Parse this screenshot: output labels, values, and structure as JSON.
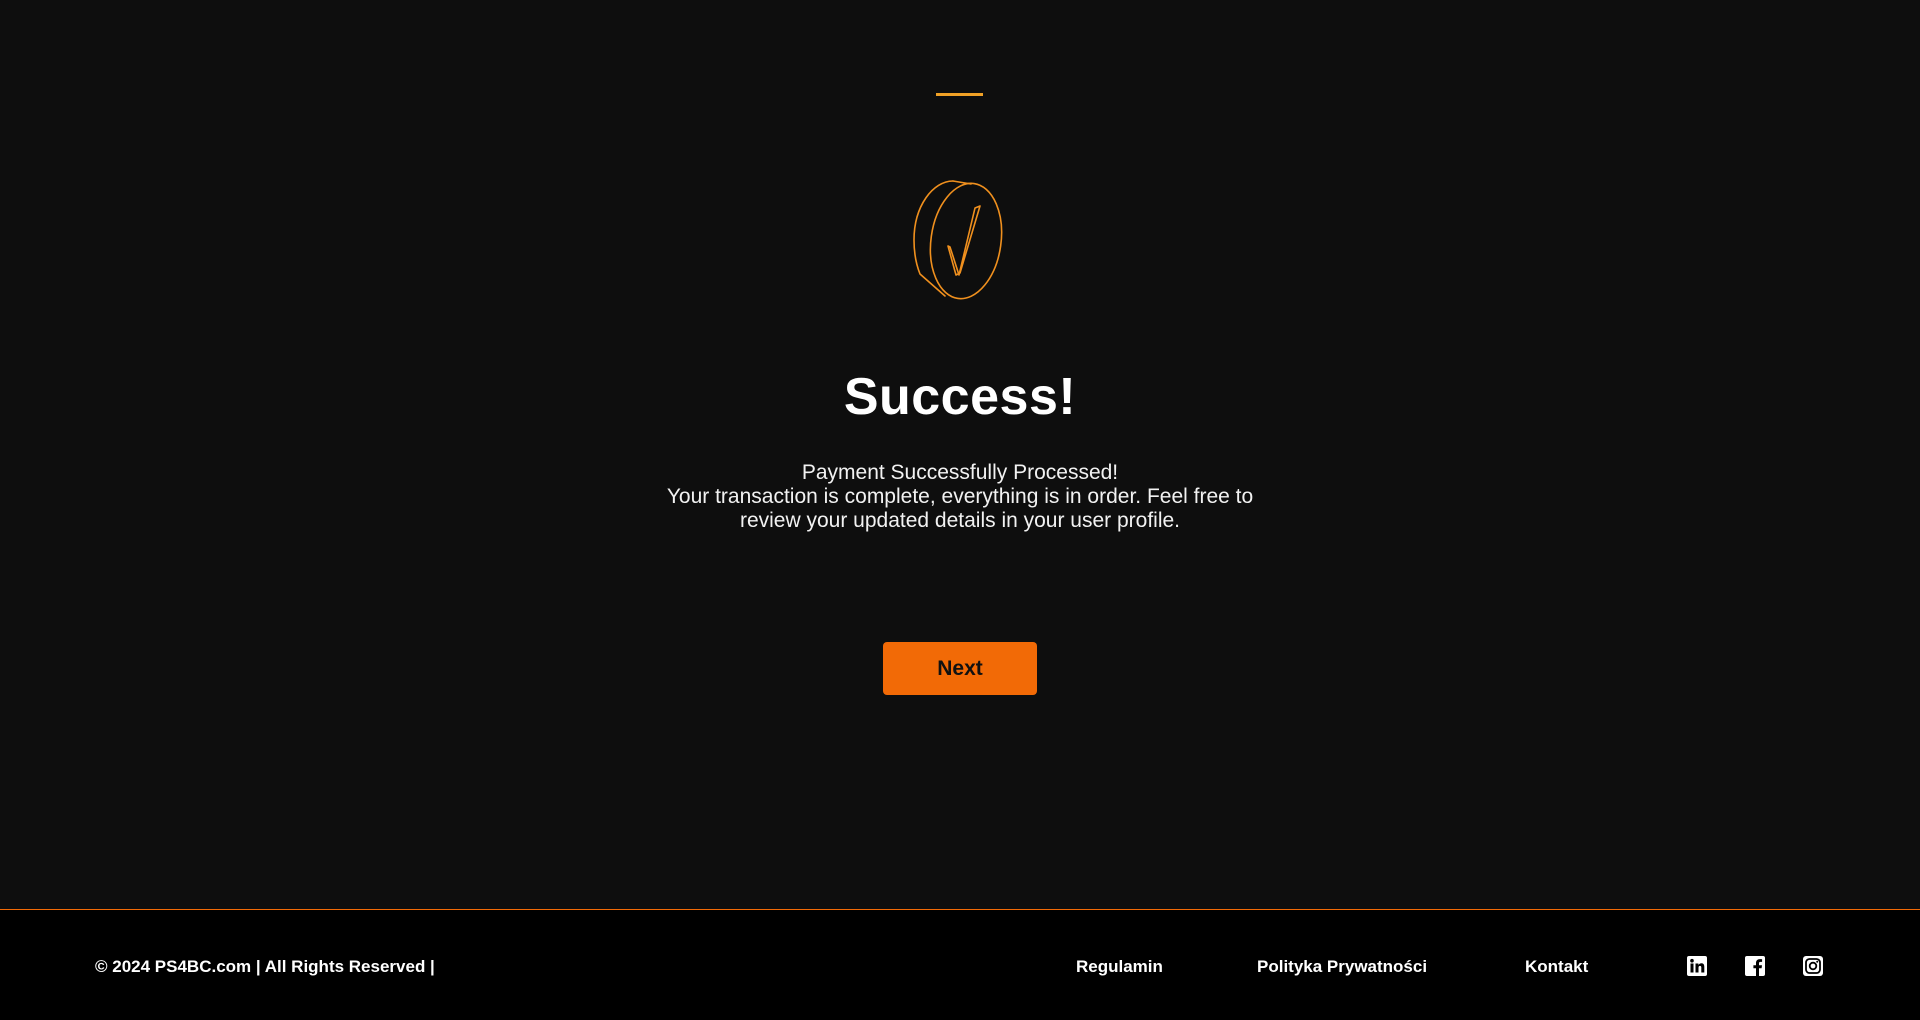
{
  "main": {
    "title": "Success!",
    "message_lines": [
      "Payment Successfully Processed!",
      "Your transaction is complete, everything is in order. Feel free to",
      "review your updated details in your user profile."
    ],
    "icon": "checkmark-coin-icon",
    "next_button": "Next"
  },
  "footer": {
    "copyright": "© 2024 PS4BC.com | All Rights Reserved |",
    "links": [
      "Regulamin",
      "Polityka Prywatności",
      "Kontakt"
    ],
    "social": [
      "linkedin-icon",
      "facebook-icon",
      "instagram-icon"
    ]
  },
  "colors": {
    "background": "#0e0e0e",
    "accent": "#f26a06",
    "accent_line": "#f0a126",
    "footer_background": "#000000",
    "text": "#ffffff"
  }
}
